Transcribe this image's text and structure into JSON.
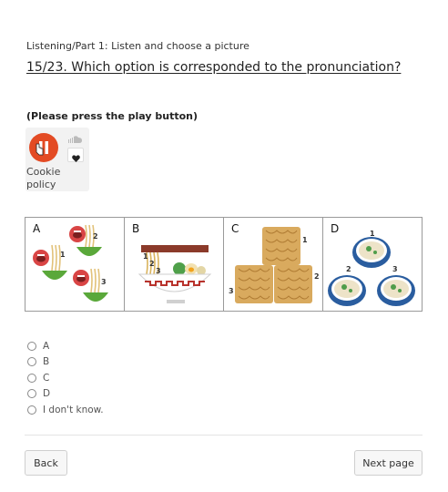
{
  "section_label": "Listening/Part 1: Listen and choose a picture",
  "question": "15/23. Which option is corresponded to the pronunciation?",
  "instruction": "(Please press the play button)",
  "player": {
    "cookie_label": "Cookie policy",
    "play_icon": "play-pause-icon",
    "cloud_icon": "soundcloud-icon",
    "heart_icon": "heart-icon",
    "accent_color": "#e34b24"
  },
  "options_grid": [
    {
      "letter": "A",
      "numbers": [
        "1",
        "2",
        "3"
      ]
    },
    {
      "letter": "B",
      "numbers": [
        "1",
        "2",
        "3"
      ]
    },
    {
      "letter": "C",
      "numbers": [
        "1",
        "2",
        "3"
      ]
    },
    {
      "letter": "D",
      "numbers": [
        "1",
        "2",
        "3"
      ]
    }
  ],
  "answers": [
    "A",
    "B",
    "C",
    "D",
    "I don't know."
  ],
  "buttons": {
    "back": "Back",
    "next": "Next page"
  }
}
